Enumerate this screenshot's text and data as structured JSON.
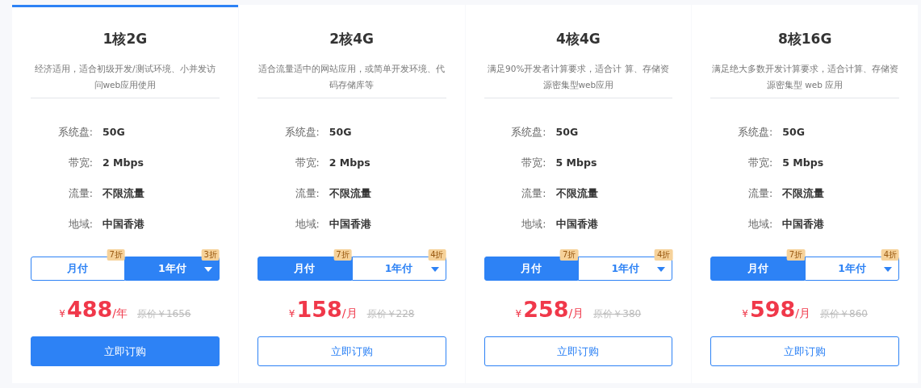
{
  "plans": [
    {
      "title": "1核2G",
      "selected": true,
      "description": "经济适用，适合初级开发/测试环境、小并发访问web应用使用",
      "specs": [
        {
          "label": "系统盘:",
          "value": "50G"
        },
        {
          "label": "带宽:",
          "value": "2 Mbps"
        },
        {
          "label": "流量:",
          "value": "不限流量"
        },
        {
          "label": "地域:",
          "value": "中国香港"
        }
      ],
      "billing": [
        {
          "label": "月付",
          "discount": "7折",
          "selected": false,
          "kind": "plain"
        },
        {
          "label": "1年付",
          "discount": "3折",
          "selected": true,
          "kind": "dropdown"
        }
      ],
      "price": {
        "currency": "¥",
        "amount": "488",
        "unit": "/年",
        "original": "原价￥1656"
      },
      "button": "立即订购"
    },
    {
      "title": "2核4G",
      "selected": false,
      "description": "适合流量适中的网站应用，或简单开发环境、代码存储库等",
      "specs": [
        {
          "label": "系统盘:",
          "value": "50G"
        },
        {
          "label": "带宽:",
          "value": "2 Mbps"
        },
        {
          "label": "流量:",
          "value": "不限流量"
        },
        {
          "label": "地域:",
          "value": "中国香港"
        }
      ],
      "billing": [
        {
          "label": "月付",
          "discount": "7折",
          "selected": true,
          "kind": "plain"
        },
        {
          "label": "1年付",
          "discount": "4折",
          "selected": false,
          "kind": "dropdown"
        }
      ],
      "price": {
        "currency": "¥",
        "amount": "158",
        "unit": "/月",
        "original": "原价￥228"
      },
      "button": "立即订购"
    },
    {
      "title": "4核4G",
      "selected": false,
      "description": "满足90%开发者计算要求，适合计 算、存储资源密集型web应用",
      "specs": [
        {
          "label": "系统盘:",
          "value": "50G"
        },
        {
          "label": "带宽:",
          "value": "5 Mbps"
        },
        {
          "label": "流量:",
          "value": "不限流量"
        },
        {
          "label": "地域:",
          "value": "中国香港"
        }
      ],
      "billing": [
        {
          "label": "月付",
          "discount": "7折",
          "selected": true,
          "kind": "plain"
        },
        {
          "label": "1年付",
          "discount": "4折",
          "selected": false,
          "kind": "dropdown"
        }
      ],
      "price": {
        "currency": "¥",
        "amount": "258",
        "unit": "/月",
        "original": "原价￥380"
      },
      "button": "立即订购"
    },
    {
      "title": "8核16G",
      "selected": false,
      "description": "满足绝大多数开发计算要求，适合计算、存储资源密集型 web 应用",
      "specs": [
        {
          "label": "系统盘:",
          "value": "50G"
        },
        {
          "label": "带宽:",
          "value": "5 Mbps"
        },
        {
          "label": "流量:",
          "value": "不限流量"
        },
        {
          "label": "地域:",
          "value": "中国香港"
        }
      ],
      "billing": [
        {
          "label": "月付",
          "discount": "7折",
          "selected": true,
          "kind": "plain"
        },
        {
          "label": "1年付",
          "discount": "4折",
          "selected": false,
          "kind": "dropdown"
        }
      ],
      "price": {
        "currency": "¥",
        "amount": "598",
        "unit": "/月",
        "original": "原价￥860"
      },
      "button": "立即订购"
    }
  ]
}
